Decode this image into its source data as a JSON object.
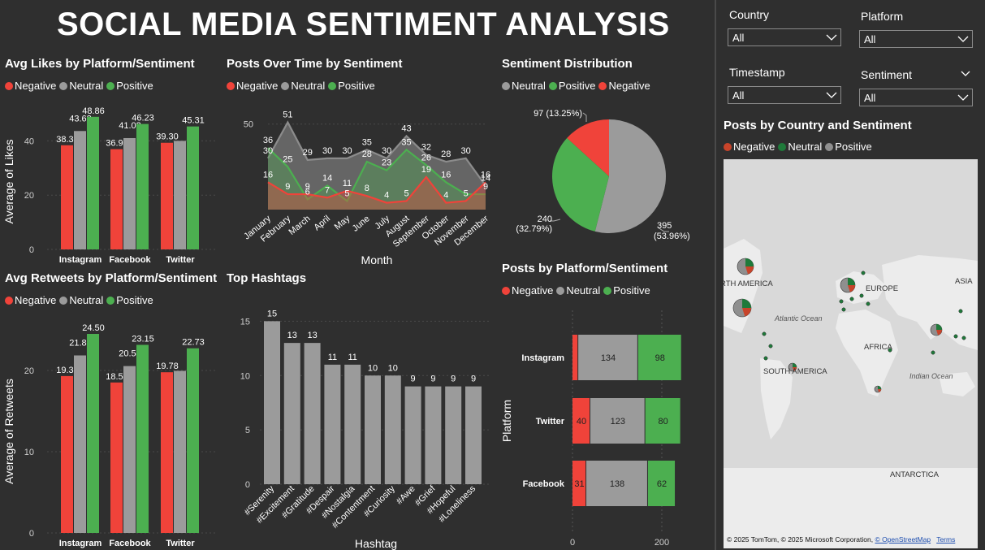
{
  "page": {
    "title": "SOCIAL MEDIA SENTIMENT ANALYSIS"
  },
  "colors": {
    "negative": "#f0433a",
    "neutral": "#9b9b9b",
    "positive": "#4caf50",
    "background": "#2f2f2f"
  },
  "legend_std": {
    "neg": "Negative",
    "neu": "Neutral",
    "pos": "Positive"
  },
  "likes": {
    "title": "Avg Likes by Platform/Sentiment",
    "chart_data": {
      "type": "bar",
      "categories": [
        "Instagram",
        "Facebook",
        "Twitter"
      ],
      "series": [
        {
          "name": "Negative",
          "values": [
            38.38,
            36.94,
            39.3
          ]
        },
        {
          "name": "Neutral",
          "values": [
            43.63,
            41.02,
            40.0
          ]
        },
        {
          "name": "Positive",
          "values": [
            48.86,
            46.23,
            45.31
          ]
        }
      ],
      "labels": [
        [
          "38.38",
          "43.63",
          "48.86"
        ],
        [
          "36.94",
          "41.02",
          "46.23"
        ],
        [
          "39.30",
          "",
          "45.31"
        ]
      ],
      "ylabel": "Average of Likes",
      "yticks": [
        0,
        20,
        40
      ],
      "ylim": [
        0,
        50
      ]
    }
  },
  "retweets": {
    "title": "Avg Retweets by Platform/Sentiment",
    "chart_data": {
      "type": "bar",
      "categories": [
        "Instagram",
        "Facebook",
        "Twitter"
      ],
      "series": [
        {
          "name": "Negative",
          "values": [
            19.31,
            18.52,
            19.78
          ]
        },
        {
          "name": "Neutral",
          "values": [
            21.85,
            20.54,
            19.95
          ]
        },
        {
          "name": "Positive",
          "values": [
            24.5,
            23.15,
            22.73
          ]
        }
      ],
      "labels": [
        [
          "19.31",
          "21.85",
          "24.50"
        ],
        [
          "18.52",
          "20.54",
          "23.15"
        ],
        [
          "19.78",
          "",
          "22.73"
        ]
      ],
      "ylabel": "Average of Retweets",
      "yticks": [
        0,
        10,
        20
      ],
      "ylim": [
        0,
        25
      ]
    }
  },
  "posts_time": {
    "title": "Posts Over Time by Sentiment",
    "chart_data": {
      "type": "area",
      "x": [
        "January",
        "February",
        "March",
        "April",
        "May",
        "June",
        "July",
        "August",
        "September",
        "October",
        "November",
        "December"
      ],
      "series": [
        {
          "name": "Neutral",
          "values": [
            30,
            51,
            29,
            30,
            30,
            35,
            30,
            43,
            32,
            28,
            30,
            14
          ]
        },
        {
          "name": "Positive",
          "values": [
            36,
            25,
            6,
            14,
            5,
            28,
            23,
            35,
            26,
            16,
            9,
            9
          ]
        },
        {
          "name": "Negative",
          "values": [
            16,
            9,
            9,
            7,
            11,
            8,
            4,
            5,
            19,
            4,
            5,
            16
          ]
        }
      ],
      "labels": {
        "neutral": [
          "30",
          "51",
          "29",
          "30",
          "30",
          "35",
          "30",
          "43",
          "32",
          "28",
          "30",
          "14"
        ],
        "positive": [
          "36",
          "25",
          "6",
          "14",
          "5",
          "28",
          "23",
          "35",
          "26",
          "16",
          "",
          "9"
        ],
        "negative": [
          "16",
          "9",
          "9",
          "7",
          "11",
          "8",
          "4",
          "5",
          "19",
          "4",
          "5",
          "16"
        ]
      },
      "xlabel": "Month",
      "yticks": [
        50
      ],
      "ylim": [
        0,
        57
      ]
    }
  },
  "sentiment": {
    "title": "Sentiment Distribution",
    "legend_order": [
      "Neutral",
      "Positive",
      "Negative"
    ],
    "chart_data": {
      "type": "pie",
      "slices": [
        {
          "name": "Neutral",
          "value": 395,
          "label": "395",
          "pct": "(53.96%)"
        },
        {
          "name": "Positive",
          "value": 240,
          "label": "240",
          "pct": "(32.79%)"
        },
        {
          "name": "Negative",
          "value": 97,
          "label": "97 (13.25%)",
          "pct": ""
        }
      ]
    }
  },
  "hashtags": {
    "title": "Top Hashtags",
    "chart_data": {
      "type": "bar",
      "categories": [
        "#Serenity",
        "#Excitement",
        "#Gratitude",
        "#Despair",
        "#Nostalgia",
        "#Contentment",
        "#Curiosity",
        "#Awe",
        "#Grief",
        "#Hopeful",
        "#Loneliness"
      ],
      "values": [
        15,
        13,
        13,
        11,
        11,
        10,
        10,
        9,
        9,
        9,
        9
      ],
      "xlabel": "Hashtag",
      "yticks": [
        0,
        5,
        10,
        15
      ],
      "ylim": [
        0,
        16
      ]
    }
  },
  "platform_posts": {
    "title": "Posts by Platform/Sentiment",
    "chart_data": {
      "type": "bar",
      "orientation": "horizontal",
      "categories": [
        "Instagram",
        "Twitter",
        "Facebook"
      ],
      "series": [
        {
          "name": "Negative",
          "values": [
            13,
            40,
            31
          ]
        },
        {
          "name": "Neutral",
          "values": [
            134,
            123,
            138
          ]
        },
        {
          "name": "Positive",
          "values": [
            98,
            80,
            62
          ]
        }
      ],
      "labels": [
        [
          "",
          "134",
          "98"
        ],
        [
          "40",
          "123",
          "80"
        ],
        [
          "31",
          "138",
          "62"
        ]
      ],
      "ylabel": "Platform",
      "xticks": [
        0,
        200
      ],
      "xlim": [
        0,
        245
      ]
    }
  },
  "slicers": {
    "country": {
      "label": "Country",
      "value": "All"
    },
    "platform": {
      "label": "Platform",
      "value": "All"
    },
    "timestamp": {
      "label": "Timestamp",
      "value": "All"
    },
    "sentiment": {
      "label": "Sentiment",
      "value": "All"
    }
  },
  "map": {
    "title": "Posts by Country and Sentiment",
    "legend": {
      "neg": "Negative",
      "neu": "Neutral",
      "pos": "Positive"
    },
    "labels": {
      "north_america": "RTH AMERICA",
      "europe": "EUROPE",
      "asia": "ASIA",
      "atlantic": "Atlantic Ocean",
      "africa": "AFRICA",
      "south_america": "SOUTH AMERICA",
      "indian": "Indian Ocean",
      "antarctica": "ANTARCTICA"
    },
    "attribution": {
      "text": "© 2025 TomTom, © 2025 Microsoft Corporation, ",
      "osm": "© OpenStreetMap",
      "terms": "Terms"
    }
  }
}
